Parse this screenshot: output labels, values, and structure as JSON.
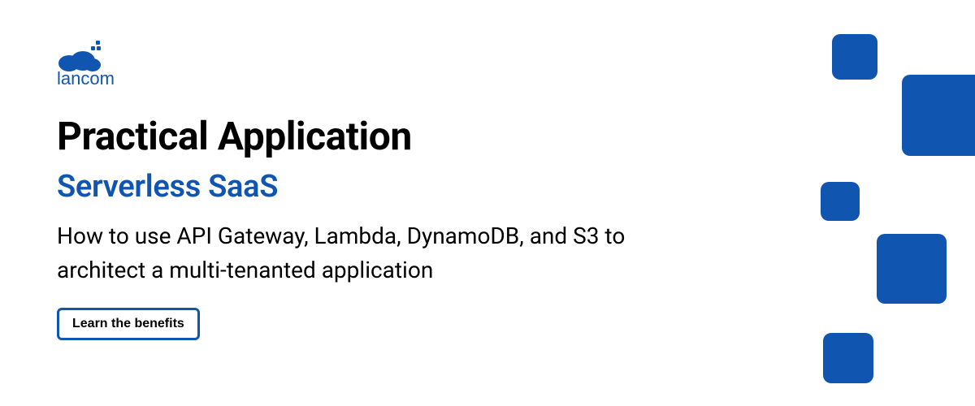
{
  "brand": {
    "name": "lancom",
    "color": "#1056b0"
  },
  "heading": "Practical Application",
  "subheading": "Serverless SaaS",
  "description": "How to use API Gateway, Lambda, DynamoDB, and S3 to architect a multi-tenanted application",
  "cta": {
    "label": "Learn the benefits"
  }
}
